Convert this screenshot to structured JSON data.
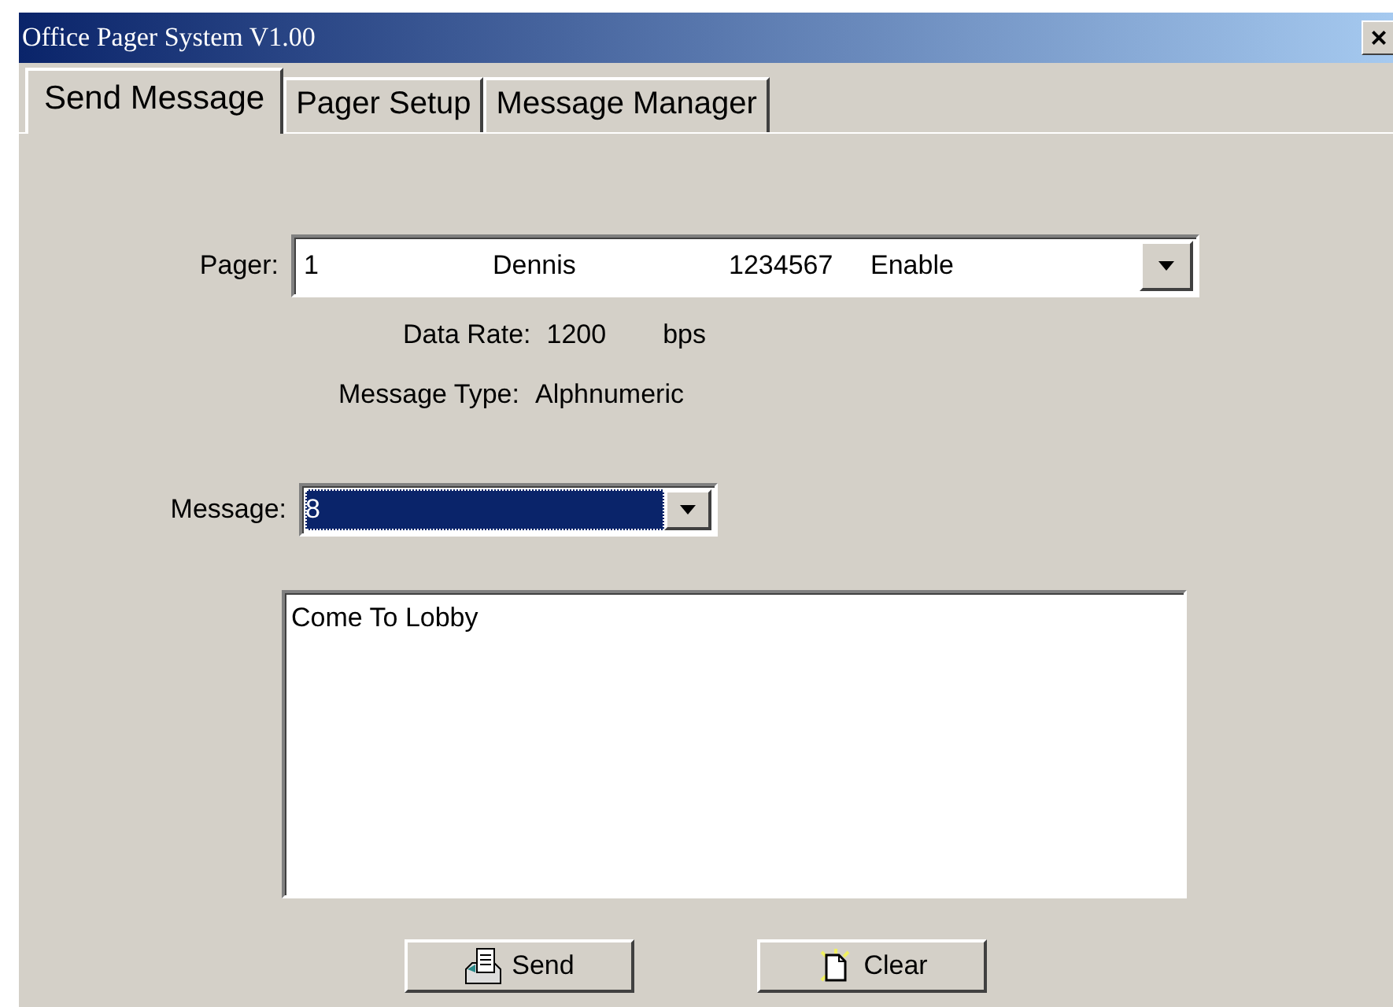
{
  "window": {
    "title": "Office Pager System V1.00",
    "close": "×"
  },
  "tabs": [
    {
      "label": "Send Message",
      "selected": true
    },
    {
      "label": "Pager Setup",
      "selected": false
    },
    {
      "label": "Message Manager",
      "selected": false
    }
  ],
  "pager": {
    "label": "Pager:",
    "columns": [
      "1",
      "Dennis",
      "1234567",
      "Enable"
    ]
  },
  "data_rate": {
    "label": "Data Rate:",
    "value": "1200",
    "unit": "bps"
  },
  "message_type": {
    "label": "Message Type:",
    "value": "Alphnumeric"
  },
  "message": {
    "label": "Message:",
    "value": "8",
    "focused": true,
    "text": "Come To Lobby"
  },
  "buttons": [
    {
      "kind": "send",
      "label": "Send"
    },
    {
      "kind": "clear",
      "label": "Clear"
    }
  ]
}
